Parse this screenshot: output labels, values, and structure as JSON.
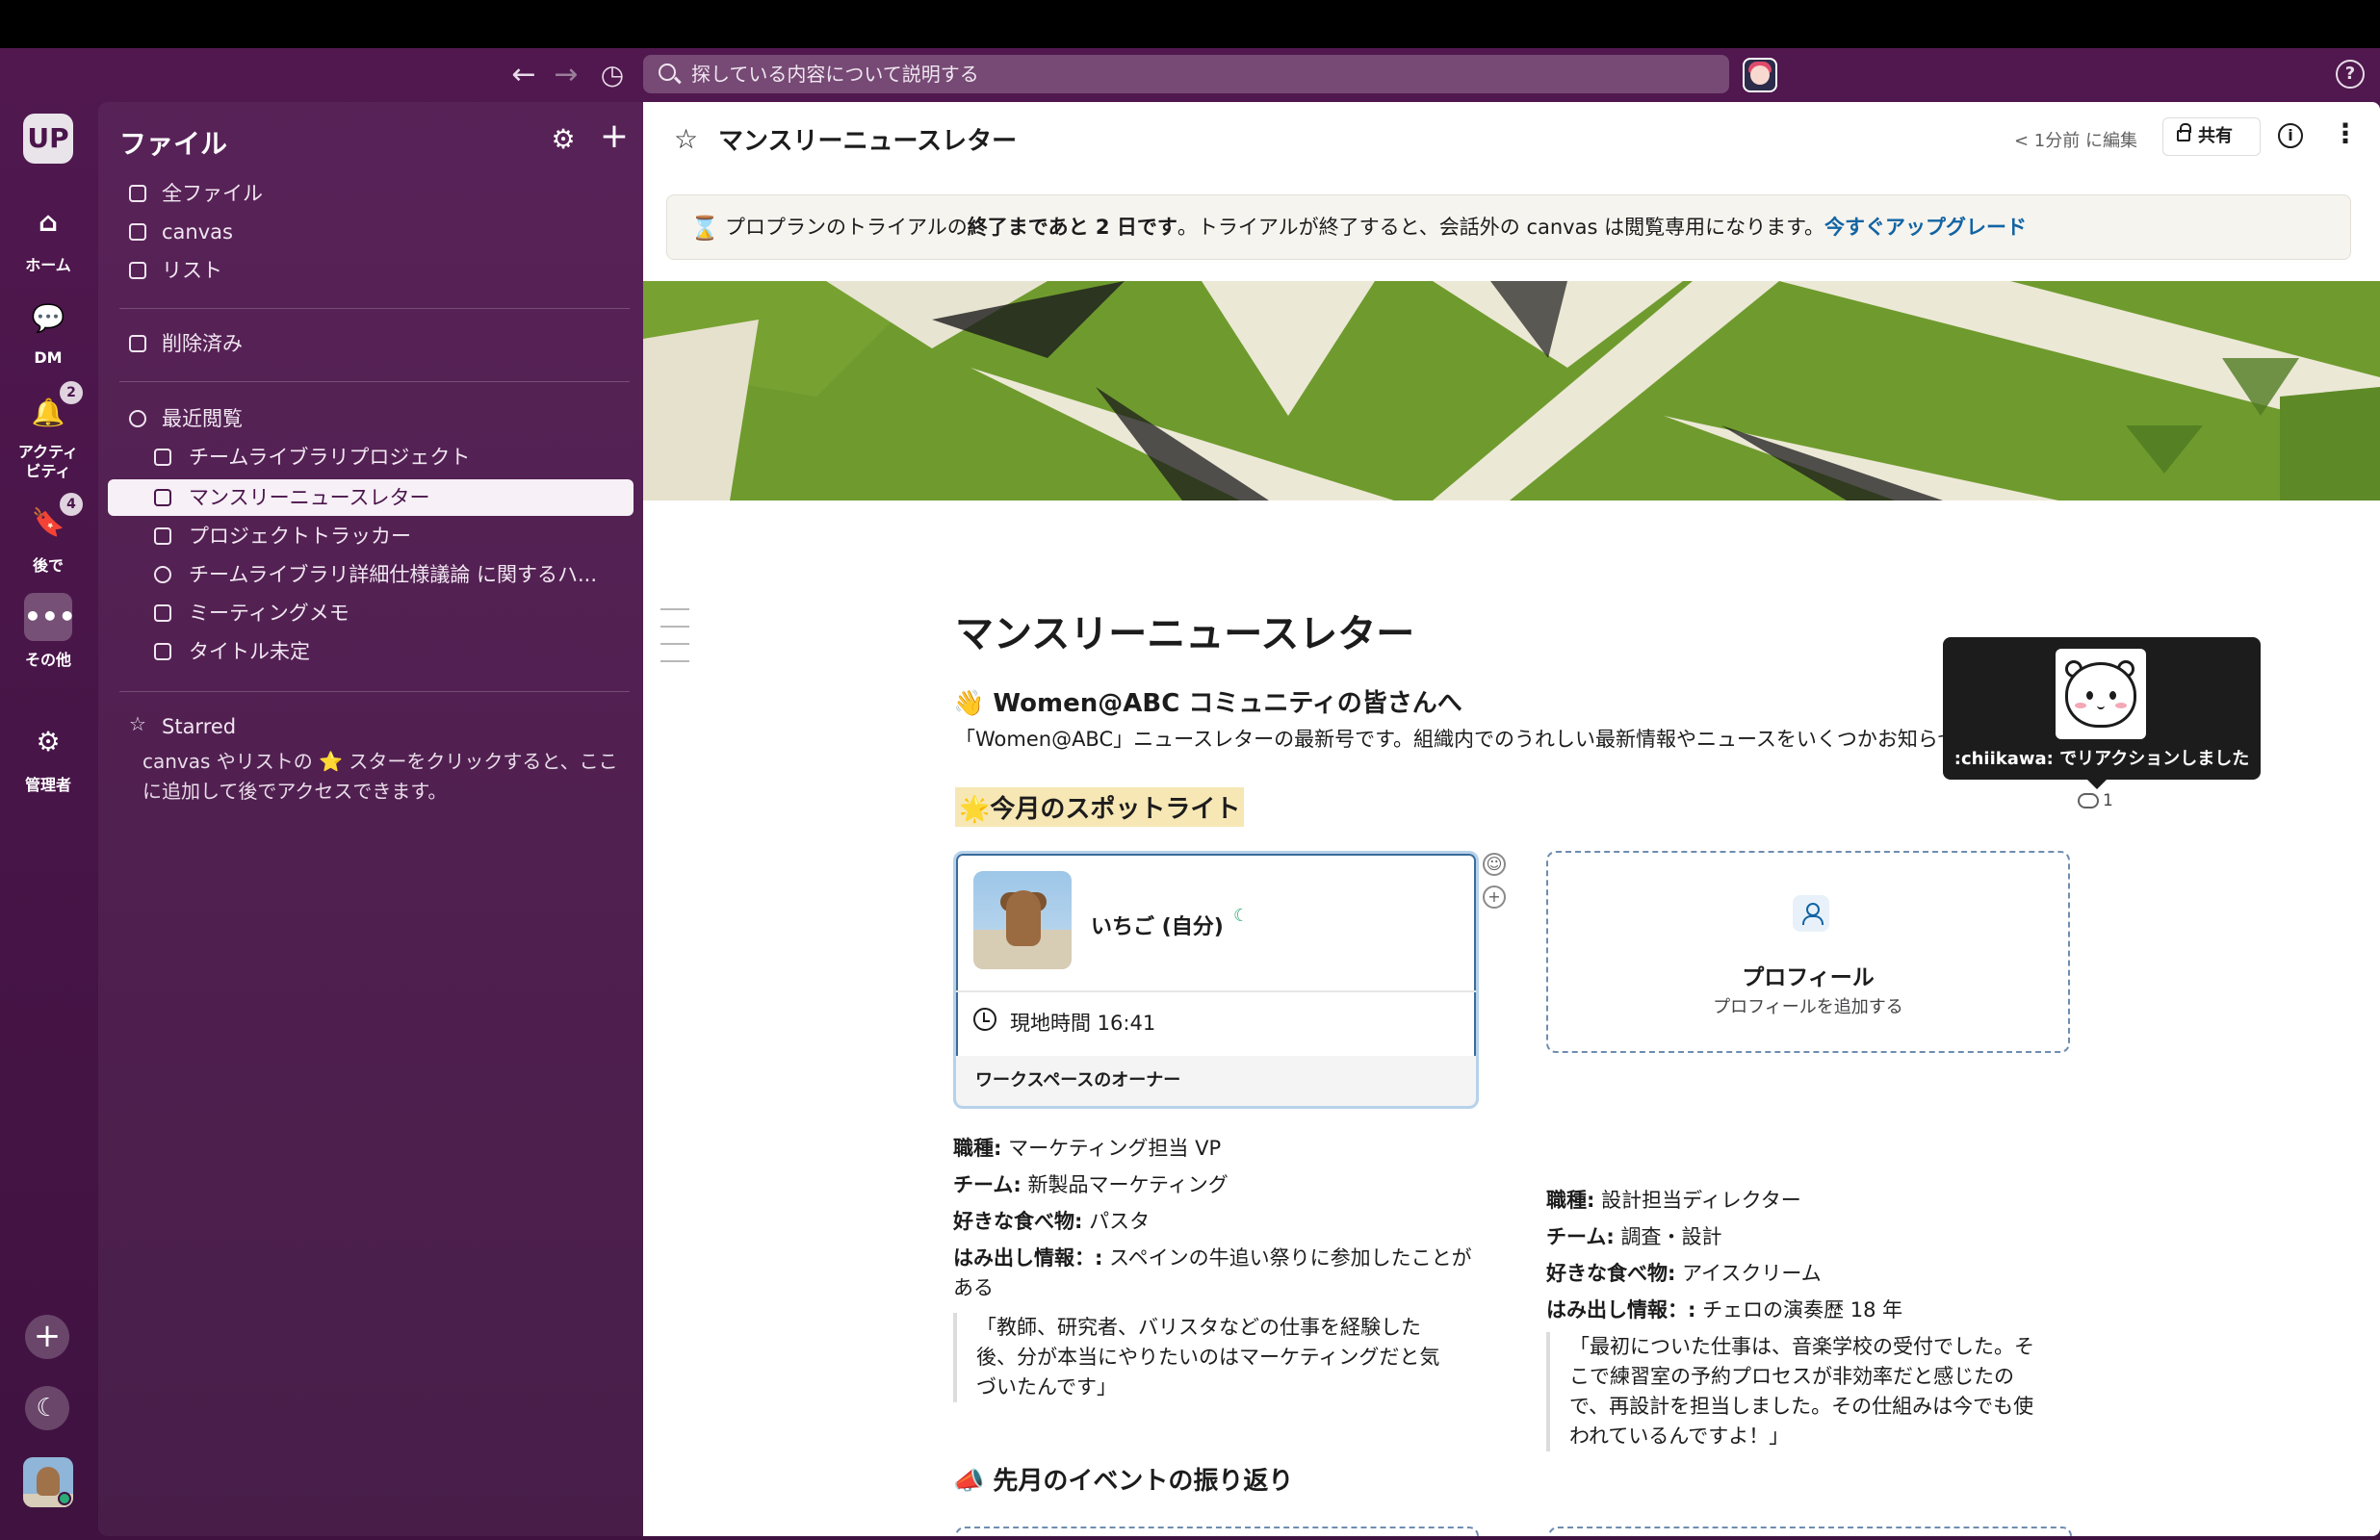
{
  "search": {
    "placeholder": "探している内容について説明する"
  },
  "rail": {
    "workspace": "UP",
    "items": [
      {
        "label": "ホーム",
        "icon": "home-icon"
      },
      {
        "label": "DM",
        "icon": "dm-icon"
      },
      {
        "label": "アクティビティ",
        "icon": "bell-icon",
        "badge": "2"
      },
      {
        "label": "後で",
        "icon": "bookmark-icon",
        "badge": "4"
      },
      {
        "label": "その他",
        "icon": "more-icon"
      },
      {
        "label": "管理者",
        "icon": "admin-gear-icon"
      }
    ]
  },
  "sidebar": {
    "title": "ファイル",
    "top_items": [
      "全ファイル",
      "canvas",
      "リスト"
    ],
    "deleted": "削除済み",
    "recent_label": "最近閲覧",
    "recent_items": [
      "チームライブラリプロジェクト",
      "マンスリーニュースレター",
      "プロジェクトトラッカー",
      "チームライブラリ詳細仕様議論 に関するハ...",
      "ミーティングメモ",
      "タイトル未定"
    ],
    "starred_label": "Starred",
    "starred_text": "canvas やリストの ⭐ スターをクリックすると、ここに追加して後でアクセスできます。"
  },
  "header": {
    "title": "マンスリーニュースレター",
    "edited": "< 1分前 に編集",
    "share": "共有"
  },
  "banner": {
    "pre": "プロプランのトライアルの",
    "bold": "終了まであと 2 日です",
    "post": "。トライアルが終了すると、会話外の canvas は閲覧専用になります。",
    "link": "今すぐアップグレード"
  },
  "doc": {
    "title": "マンスリーニュースレター",
    "greeting": "👋 Women@ABC コミュニティの皆さんへ",
    "intro": "「Women@ABC」ニュースレターの最新号です。組織内でのうれしい最新情報やニュースをいくつかお知らせ",
    "spotlight": "🌟今月のスポットライト",
    "events": "📣 先月のイベントの振り返り"
  },
  "card1": {
    "name": "いちご (自分)",
    "time": "現地時間 16:41",
    "role": "ワークスペースのオーナー"
  },
  "card2": {
    "title": "プロフィール",
    "sub": "プロフィールを追加する"
  },
  "person1": {
    "f1k": "職種:",
    "f1v": " マーケティング担当 VP",
    "f2k": "チーム:",
    "f2v": " 新製品マーケティング",
    "f3k": "好きな食べ物:",
    "f3v": " パスタ",
    "f4k": "はみ出し情報：:",
    "f4v": " スペインの牛追い祭りに参加したことがある",
    "quote": "「教師、研究者、バリスタなどの仕事を経験した後、分が本当にやりたいのはマーケティングだと気づいたんです」"
  },
  "person2": {
    "f1k": "職種:",
    "f1v": " 設計担当ディレクター",
    "f2k": "チーム:",
    "f2v": " 調査・設計",
    "f3k": "好きな食べ物:",
    "f3v": " アイスクリーム",
    "f4k": "はみ出し情報：:",
    "f4v": " チェロの演奏歴 18 年",
    "quote": "「最初についた仕事は、音楽学校の受付でした。そこで練習室の予約プロセスが非効率だと感じたので、再設計を担当しました。その仕組みは今でも使われているんですよ！」"
  },
  "tooltip": {
    "text": ":chiikawa: でリアクションしました",
    "count": "1"
  }
}
